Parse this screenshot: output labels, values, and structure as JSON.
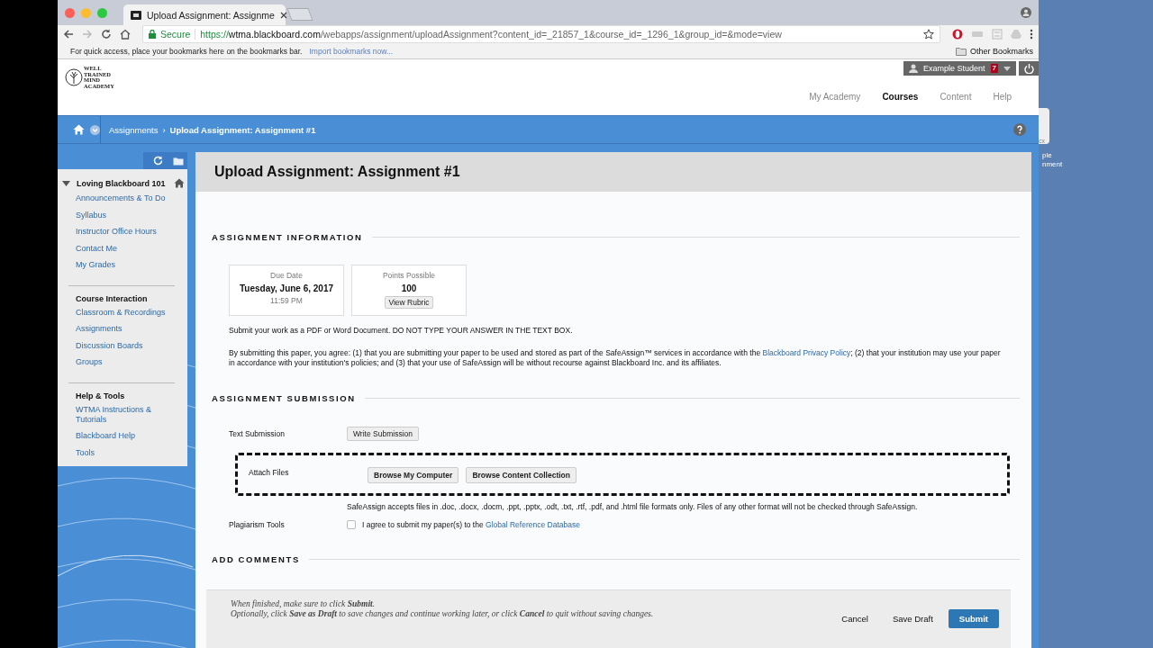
{
  "browser": {
    "tab_title": "Upload Assignment: Assignme",
    "secure_label": "Secure",
    "url_scheme": "https://",
    "url_host": "wtma.blackboard.com",
    "url_path": "/webapps/assignment/uploadAssignment?content_id=_21857_1&course_id=_1296_1&group_id=&mode=view",
    "bookmarks_hint": "For quick access, place your bookmarks here on the bookmarks bar.",
    "import_link": "Import bookmarks now...",
    "other_bookmarks": "Other Bookmarks"
  },
  "header": {
    "logo_lines": [
      "WELL",
      "TRAINED",
      "MIND",
      "ACADEMY"
    ],
    "user_name": "Example Student",
    "notification_count": "7",
    "nav": [
      {
        "label": "My Academy",
        "selected": false
      },
      {
        "label": "Courses",
        "selected": true
      },
      {
        "label": "Content",
        "selected": false
      },
      {
        "label": "Help",
        "selected": false
      }
    ]
  },
  "breadcrumb_separator": "›",
  "breadcrumb": [
    {
      "label": "Assignments",
      "current": false
    },
    {
      "label": "Upload Assignment: Assignment #1",
      "current": true
    }
  ],
  "sidebar": {
    "course": {
      "title": "Loving Blackboard 101",
      "expanded": true
    },
    "sections": [
      {
        "items": [
          "Announcements & To Do",
          "Syllabus",
          "Instructor Office Hours",
          "Contact Me",
          "My Grades"
        ]
      },
      {
        "heading": "Course Interaction",
        "items": [
          "Classroom & Recordings",
          "Assignments",
          "Discussion Boards",
          "Groups"
        ]
      },
      {
        "heading": "Help & Tools",
        "items": [
          "WTMA Instructions & Tutorials",
          "Blackboard Help",
          "Tools"
        ]
      }
    ]
  },
  "page_title": "Upload Assignment: Assignment #1",
  "info": {
    "heading": "ASSIGNMENT INFORMATION",
    "due": {
      "label": "Due Date",
      "date": "Tuesday, June 6, 2017",
      "time": "11:59 PM"
    },
    "points": {
      "label": "Points Possible",
      "value": "100",
      "button": "View Rubric"
    },
    "instruction": "Submit your work as a PDF or Word Document.  DO NOT TYPE YOUR ANSWER IN THE TEXT BOX.",
    "agreement_before": "By submitting this paper, you agree: (1) that you are submitting your paper to be used and stored as part of the SafeAssign™ services in accordance with the",
    "agreement_link": "Blackboard Privacy Policy",
    "agreement_after": "; (2) that your institution may use your paper in accordance with your institution's policies; and (3) that your use of SafeAssign will be without recourse against Blackboard Inc. and its affiliates."
  },
  "submission": {
    "heading": "ASSIGNMENT SUBMISSION",
    "text_label": "Text Submission",
    "write_button": "Write Submission",
    "attach_label": "Attach Files",
    "attach_buttons": [
      "Browse My Computer",
      "Browse Content Collection"
    ],
    "formats_note": "SafeAssign accepts files in .doc, .docx, .docm, .ppt, .pptx, .odt, .txt, .rtf, .pdf, and .html file formats only. Files of any other format will not be checked through SafeAssign.",
    "plagiarism_label": "Plagiarism Tools",
    "agree_before": "I agree to submit my paper(s) to the",
    "agree_link": "Global Reference Database",
    "agree_checked": false
  },
  "comments_heading": "ADD COMMENTS",
  "footer": {
    "lines": [
      "When finished, make sure to click **Submit**.",
      "Optionally, click **Save as Draft** to save changes and continue working later, or click **Cancel** to quit without saving changes."
    ],
    "buttons": [
      {
        "label": "Cancel",
        "kind": "plain"
      },
      {
        "label": "Save Draft",
        "kind": "plain"
      },
      {
        "label": "Submit",
        "kind": "primary"
      }
    ]
  },
  "desktop": {
    "icon_lines": [
      "ple",
      "nment"
    ],
    "partial_label": "cx"
  }
}
